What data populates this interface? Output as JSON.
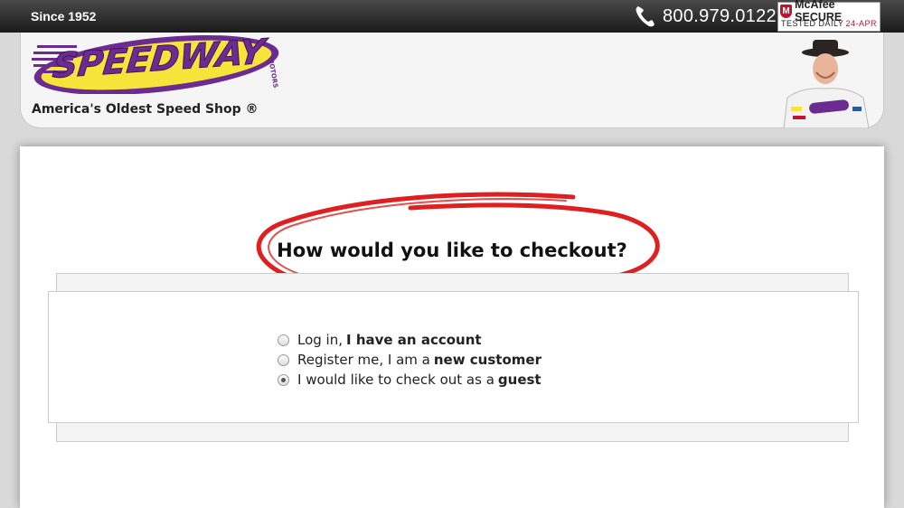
{
  "topbar": {
    "since": "Since 1952",
    "phone": "800.979.0122",
    "mcafee": {
      "label": "McAfee SECURE",
      "tested": "TESTED DAILY",
      "date": "24-APR"
    }
  },
  "header": {
    "logo_text": "SPEEDWAY",
    "logo_sub": "MOTORS",
    "tagline": "America's Oldest Speed Shop ®"
  },
  "checkout": {
    "question": "How would you like to checkout?",
    "options": [
      {
        "prefix": "Log in,",
        "bold": "I have an account",
        "checked": false
      },
      {
        "prefix": "Register me, I am a",
        "bold": "new customer",
        "checked": false
      },
      {
        "prefix": "I would like to check out as a",
        "bold": "guest",
        "checked": true
      }
    ]
  },
  "colors": {
    "brand_purple": "#6b2c91",
    "brand_yellow": "#f7e43a",
    "circle_red": "#e02020"
  }
}
